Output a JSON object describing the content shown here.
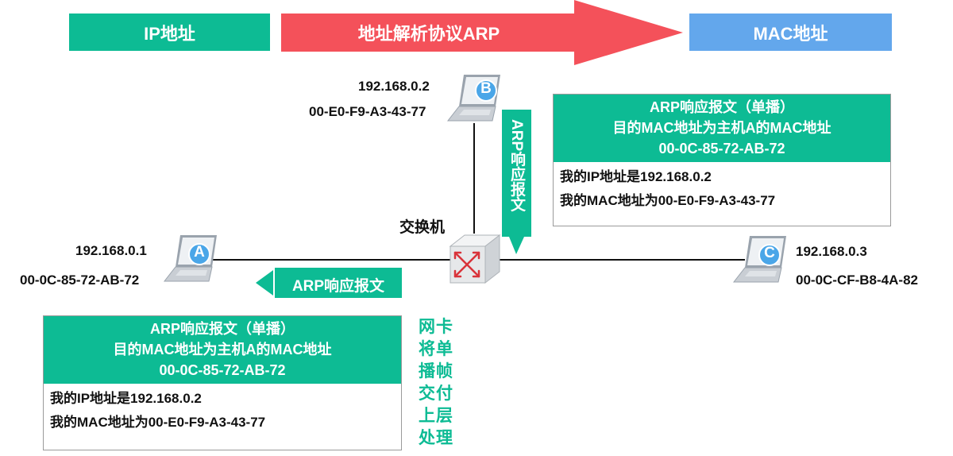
{
  "banners": {
    "ip_label": "IP地址",
    "arp_label": "地址解析协议ARP",
    "mac_label": "MAC地址"
  },
  "hosts": {
    "a": {
      "letter": "A",
      "ip": "192.168.0.1",
      "mac": "00-0C-85-72-AB-72"
    },
    "b": {
      "letter": "B",
      "ip": "192.168.0.2",
      "mac": "00-E0-F9-A3-43-77"
    },
    "c": {
      "letter": "C",
      "ip": "192.168.0.3",
      "mac": "00-0C-CF-B8-4A-82"
    }
  },
  "switch": {
    "label": "交换机"
  },
  "arrows": {
    "vertical_reply": "ARP响应报文",
    "horizontal_reply": "ARP响应报文"
  },
  "box_right": {
    "line1": "ARP响应报文（单播）",
    "line2": "目的MAC地址为主机A的MAC地址",
    "line3": "00-0C-85-72-AB-72",
    "body1": "我的IP地址是192.168.0.2",
    "body2": "我的MAC地址为00-E0-F9-A3-43-77"
  },
  "box_left": {
    "line1": "ARP响应报文（单播）",
    "line2": "目的MAC地址为主机A的MAC地址",
    "line3": "00-0C-85-72-AB-72",
    "body1": "我的IP地址是192.168.0.2",
    "body2": "我的MAC地址为00-E0-F9-A3-43-77"
  },
  "side_note": [
    "网卡",
    "将单",
    "播帧",
    "交付",
    "上层",
    "处理"
  ],
  "colors": {
    "green": "#0dbb94",
    "red": "#f4515a",
    "blue": "#63a7ec",
    "laptop_badge": "#4aa6e8"
  }
}
